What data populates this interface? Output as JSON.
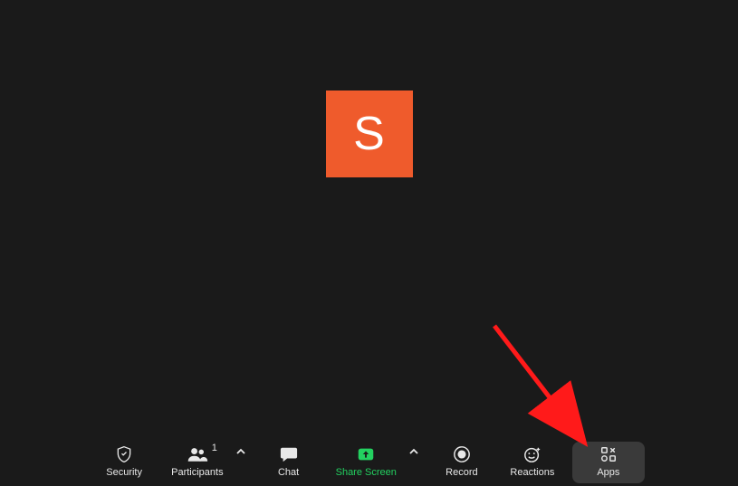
{
  "avatar": {
    "initial": "S"
  },
  "toolbar": {
    "security": {
      "label": "Security"
    },
    "participants": {
      "label": "Participants",
      "count": "1"
    },
    "chat": {
      "label": "Chat"
    },
    "share_screen": {
      "label": "Share Screen"
    },
    "record": {
      "label": "Record"
    },
    "reactions": {
      "label": "Reactions"
    },
    "apps": {
      "label": "Apps"
    }
  },
  "colors": {
    "avatar_bg": "#EF5B2C",
    "share_green": "#23D160",
    "arrow_red": "#FF1A1A"
  }
}
